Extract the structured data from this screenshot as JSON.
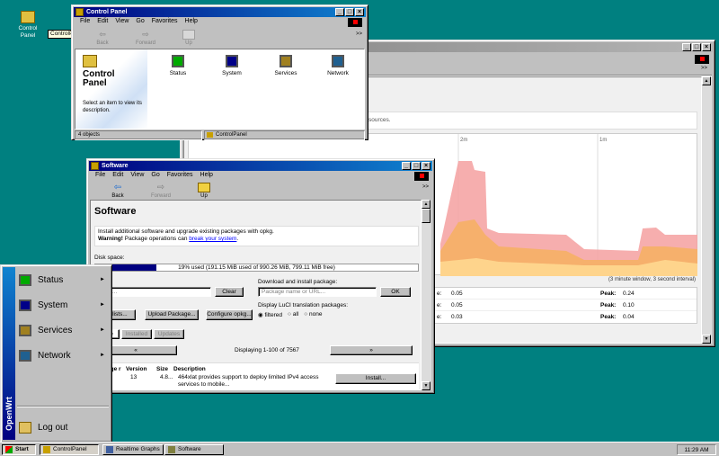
{
  "desktop": {
    "icon_label": "Control Panel",
    "tooltip": "ControlPanel"
  },
  "control_panel": {
    "title": "Control Panel",
    "menu": [
      "File",
      "Edit",
      "View",
      "Go",
      "Favorites",
      "Help"
    ],
    "toolbar": [
      "Back",
      "Forward",
      "Up"
    ],
    "header": "Control Panel",
    "description": "Select an item to view its description.",
    "items": [
      "Status",
      "System",
      "Services",
      "Network"
    ],
    "status_left": "4 objects",
    "status_right": "ControlPanel",
    "chevrons": ">>"
  },
  "graphs_window": {
    "sources_text": "sources.",
    "axis_labels": [
      "2m",
      "1m"
    ],
    "window_note": "(3 minute window, 3 second interval)",
    "rows": [
      {
        "label": "e:",
        "value": "0.05",
        "peak_label": "Peak:",
        "peak": "0.24"
      },
      {
        "label": "e:",
        "value": "0.05",
        "peak_label": "Peak:",
        "peak": "0.10"
      },
      {
        "label": "e:",
        "value": "0.03",
        "peak_label": "Peak:",
        "peak": "0.04"
      }
    ],
    "colors": {
      "series1": "#f08080",
      "series2": "#f4a460",
      "series3": "#ffd27f"
    }
  },
  "software": {
    "title": "Software",
    "menu": [
      "File",
      "Edit",
      "View",
      "Go",
      "Favorites",
      "Help"
    ],
    "toolbar": [
      "Back",
      "Forward",
      "Up"
    ],
    "heading": "Software",
    "intro": "Install additional software and upgrade existing packages with opkg.",
    "warning_bold": "Warning!",
    "warning_rest": " Package operations can ",
    "warning_link": "break your system",
    "warning_end": ".",
    "disk_label": "Disk space:",
    "disk_text": "19% used (191.15 MiB used of 990.26 MiB, 799.11 MiB free)",
    "disk_fraction": 0.19,
    "filter_placeholder": "r filter...",
    "clear_button": "Clear",
    "download_label": "Download and install package:",
    "download_placeholder": "Package name or URL...",
    "ok_button": "OK",
    "actions_label": "s:",
    "update_button": "ate lists...",
    "upload_button": "Upload Package...",
    "configure_button": "Configure opkg...",
    "luci_label": "Display LuCI translation packages:",
    "radio_options": [
      "filtered",
      "all",
      "none"
    ],
    "tabs": [
      "lable",
      "Installed",
      "Updates"
    ],
    "prev_button": "«",
    "next_button": "»",
    "displaying": "Displaying 1-100 of 7567",
    "columns": [
      "age r",
      "Version",
      "Size",
      "Description"
    ],
    "row": {
      "version": "13",
      "size": "4.8...",
      "description_line1": "464xlat provides support to deploy limited IPv4 access",
      "description_line2": "services to mobile..."
    },
    "install_button": "Install..."
  },
  "start_menu": {
    "brand": "OpenWrt",
    "items": [
      "Status",
      "System",
      "Services",
      "Network"
    ],
    "logout": "Log out",
    "arrow": "►"
  },
  "taskbar": {
    "start": "Start",
    "tasks": [
      "ControlPanel",
      "Realtime Graphs",
      "Software"
    ],
    "clock": "11:29 AM"
  }
}
